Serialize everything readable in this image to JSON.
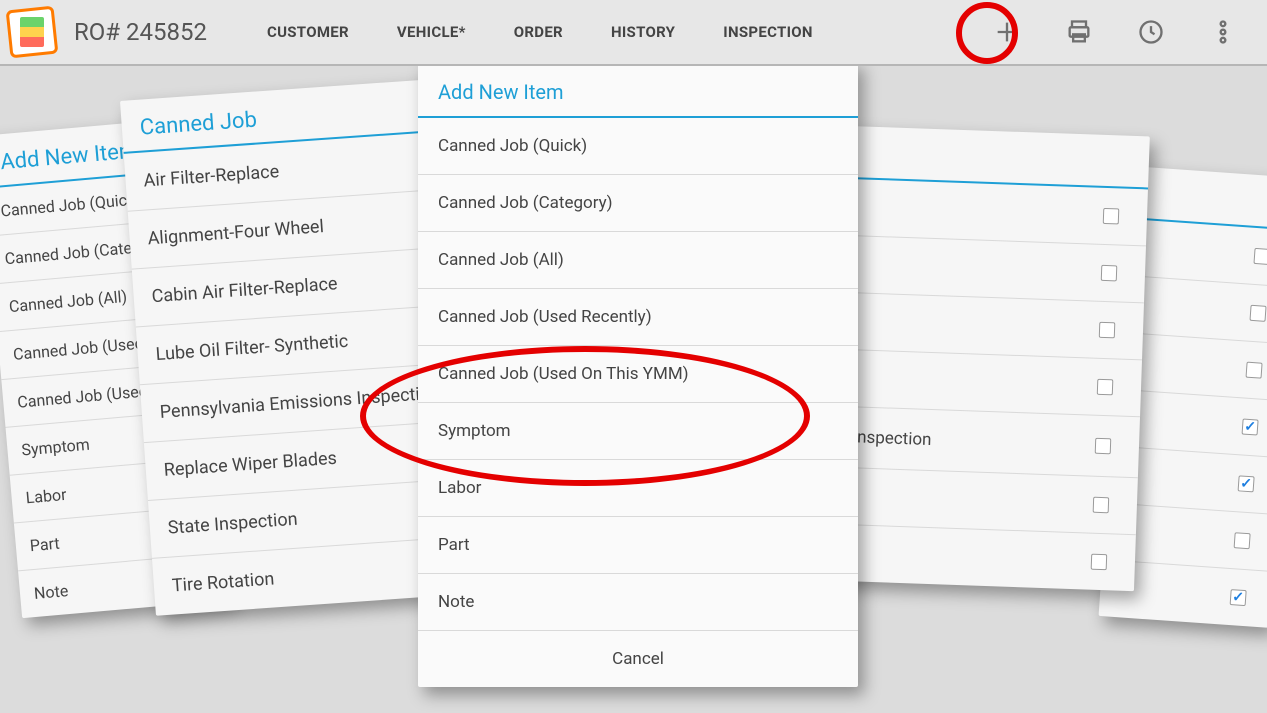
{
  "header": {
    "ro_title": "RO# 245852",
    "tabs": [
      "CUSTOMER",
      "VEHICLE*",
      "ORDER",
      "HISTORY",
      "INSPECTION"
    ]
  },
  "panels": {
    "addnew1": {
      "title": "Add New Item",
      "items": [
        "Canned Job (Quick)",
        "Canned Job (Category)",
        "Canned Job (All)",
        "Canned Job (Used Recently)",
        "Canned Job (Used On This YMM)",
        "Symptom",
        "Labor",
        "Part",
        "Note"
      ]
    },
    "canned": {
      "title": "Canned Job",
      "items": [
        "Air Filter-Replace",
        "Alignment-Four Wheel",
        "Cabin Air Filter-Replace",
        "Lube Oil Filter- Synthetic",
        "Pennsylvania Emissions Inspection",
        "Replace Wiper Blades",
        "State Inspection",
        "Tire Rotation"
      ]
    },
    "main": {
      "title": "Add New Item",
      "items": [
        "Canned Job (Quick)",
        "Canned Job (Category)",
        "Canned Job (All)",
        "Canned Job (Used Recently)",
        "Canned Job (Used On This YMM)",
        "Symptom",
        "Labor",
        "Part",
        "Note"
      ],
      "cancel": "Cancel"
    },
    "check1": {
      "label_visible": "nspection",
      "rows": [
        {
          "label": "",
          "checked": false
        },
        {
          "label": "",
          "checked": false
        },
        {
          "label": "",
          "checked": false
        },
        {
          "label": "",
          "checked": false
        },
        {
          "label": "nspection",
          "checked": false
        },
        {
          "label": "",
          "checked": false
        },
        {
          "label": "",
          "checked": false
        }
      ]
    },
    "check2": {
      "rows": [
        {
          "checked": false
        },
        {
          "checked": false
        },
        {
          "checked": false
        },
        {
          "checked": true
        },
        {
          "checked": true
        },
        {
          "checked": false
        },
        {
          "checked": true
        }
      ]
    }
  }
}
